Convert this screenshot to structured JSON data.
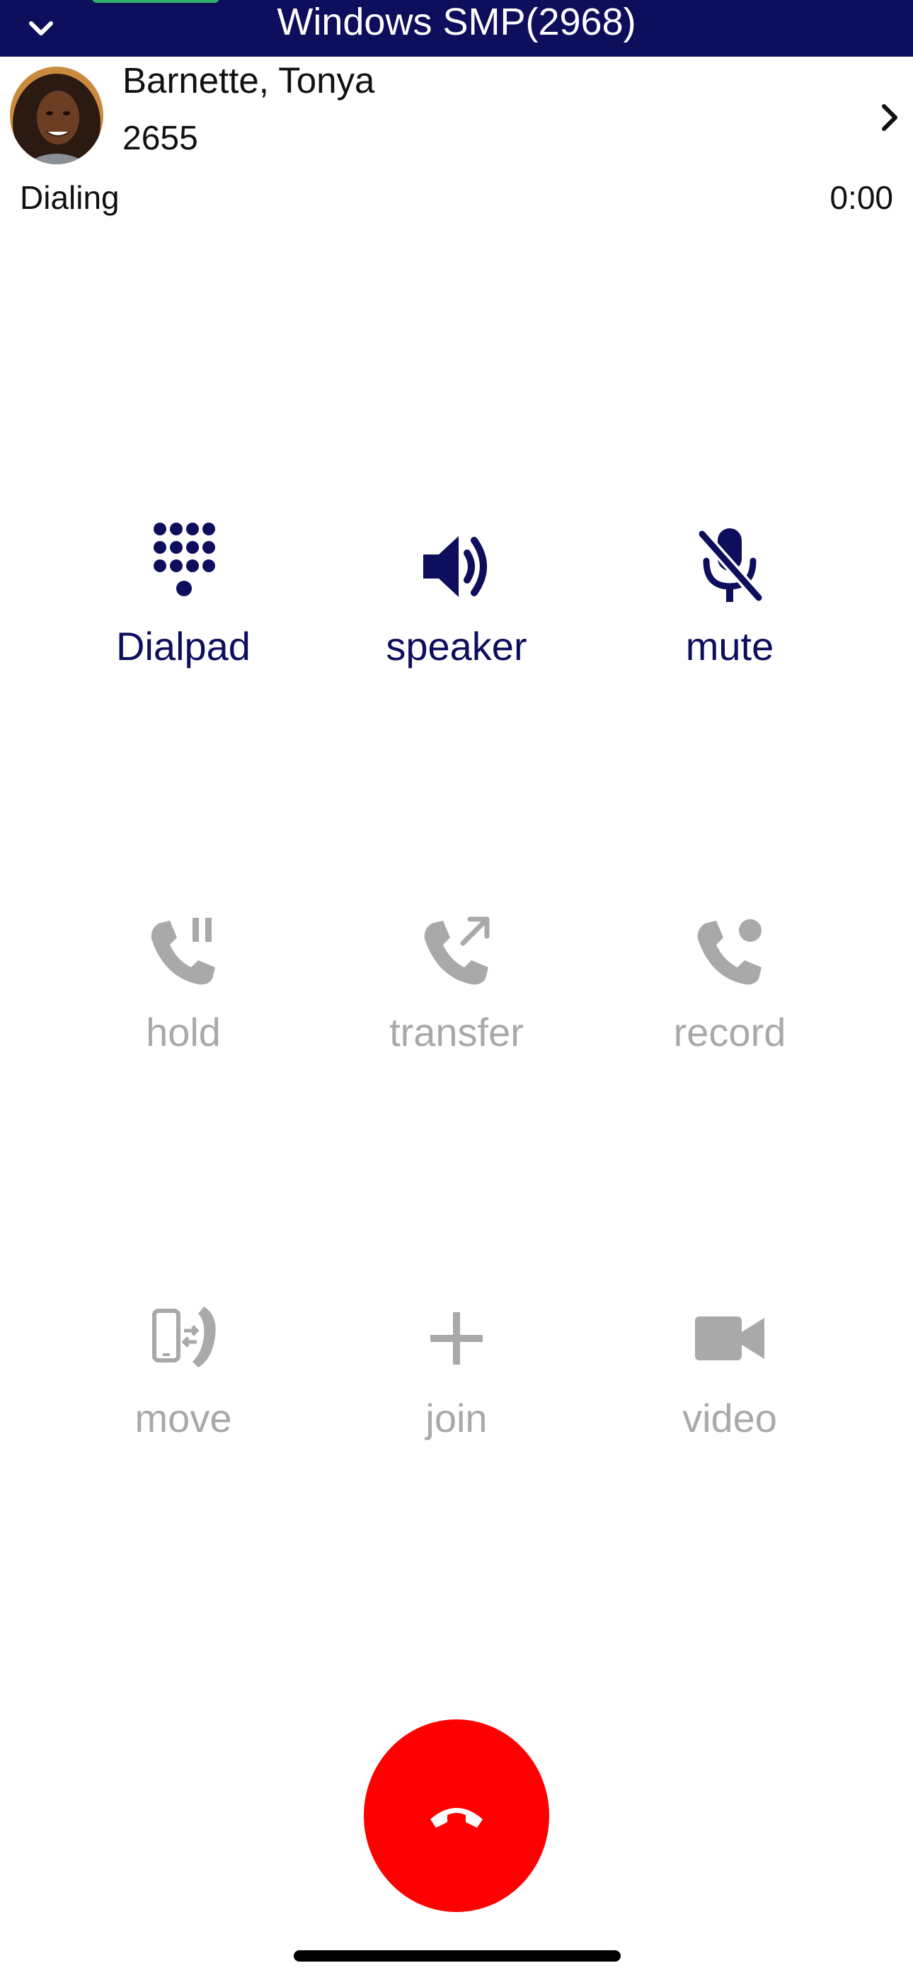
{
  "header": {
    "title": "Windows SMP(2968)",
    "collapse_icon": "chevron-down-icon",
    "background": "#0d0e5c"
  },
  "caller": {
    "name": "Barnette, Tonya",
    "extension": "2655",
    "status": "Dialing",
    "timer": "0:00",
    "details_icon": "chevron-right-icon"
  },
  "controls": {
    "dialpad": {
      "label": "Dialpad",
      "icon": "dialpad-icon",
      "enabled": true
    },
    "speaker": {
      "label": "speaker",
      "icon": "speaker-icon",
      "enabled": true
    },
    "mute": {
      "label": "mute",
      "icon": "microphone-off-icon",
      "enabled": true
    },
    "hold": {
      "label": "hold",
      "icon": "phone-hold-icon",
      "enabled": false
    },
    "transfer": {
      "label": "transfer",
      "icon": "phone-transfer-icon",
      "enabled": false
    },
    "record": {
      "label": "record",
      "icon": "phone-record-icon",
      "enabled": false
    },
    "move": {
      "label": "move",
      "icon": "move-call-icon",
      "enabled": false
    },
    "join": {
      "label": "join",
      "icon": "plus-icon",
      "enabled": false
    },
    "video": {
      "label": "video",
      "icon": "video-camera-icon",
      "enabled": false
    }
  },
  "hangup": {
    "icon": "hangup-phone-icon",
    "color": "#ff0000"
  },
  "colors": {
    "active": "#0d0e5c",
    "disabled": "#a9a9a9",
    "hangup": "#ff0000"
  }
}
